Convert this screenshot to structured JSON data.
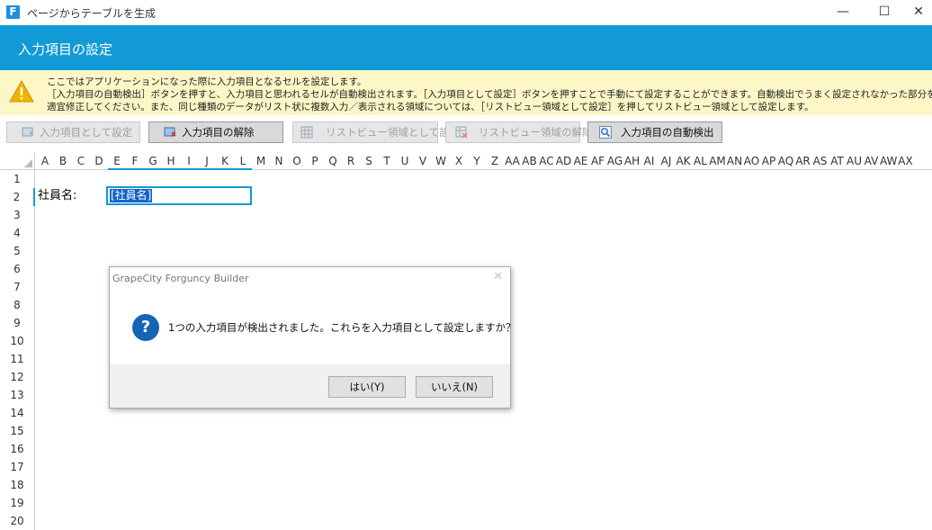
{
  "window": {
    "app_icon_letter": "F",
    "title": "ページからテーブルを生成",
    "minimize_glyph": "—",
    "maximize_glyph": "☐",
    "close_glyph": "✕"
  },
  "header": {
    "title": "入力項目の設定"
  },
  "info": {
    "icon": "warning-icon",
    "lines": [
      "ここではアプリケーションになった際に入力項目となるセルを設定します。",
      "［入力項目の自動検出］ボタンを押すと、入力項目と思われるセルが自動検出されます。［入力項目として設定］ボタンを押すことで手動にて設定することができます。自動検出でうまく設定されなかった部分を",
      "適宜修正してください。また、同じ種類のデータがリスト状に複数入力／表示される領域については、［リストビュー領域として設定］を押してリストビュー領域として設定します。"
    ]
  },
  "toolbar": {
    "set_input": "入力項目として設定",
    "remove_input": "入力項目の解除",
    "set_listview": "リストビュー領域として設定",
    "remove_listview": "リストビュー領域の解除",
    "auto_detect": "入力項目の自動検出"
  },
  "sheet": {
    "columns": [
      "A",
      "B",
      "C",
      "D",
      "E",
      "F",
      "G",
      "H",
      "I",
      "J",
      "K",
      "L",
      "M",
      "N",
      "O",
      "P",
      "Q",
      "R",
      "S",
      "T",
      "U",
      "V",
      "W",
      "X",
      "Y",
      "Z",
      "AA",
      "AB",
      "AC",
      "AD",
      "AE",
      "AF",
      "AG",
      "AH",
      "AI",
      "AJ",
      "AK",
      "AL",
      "AM",
      "AN",
      "AO",
      "AP",
      "AQ",
      "AR",
      "AS",
      "AT",
      "AU",
      "AV",
      "AW",
      "AX"
    ],
    "rows": [
      "1",
      "2",
      "3",
      "4",
      "5",
      "6",
      "7",
      "8",
      "9",
      "10",
      "11",
      "12",
      "13",
      "14",
      "15",
      "16",
      "17",
      "18",
      "19",
      "20"
    ],
    "label_cell": "社員名:",
    "selected_cell": "[社員名]"
  },
  "dialog": {
    "title": "GrapeCity Forguncy Builder",
    "close_glyph": "✕",
    "icon_glyph": "?",
    "message": "1つの入力項目が検出されました。これらを入力項目として設定しますか？",
    "yes_label": "はい(Y)",
    "no_label": "いいえ(N)"
  }
}
